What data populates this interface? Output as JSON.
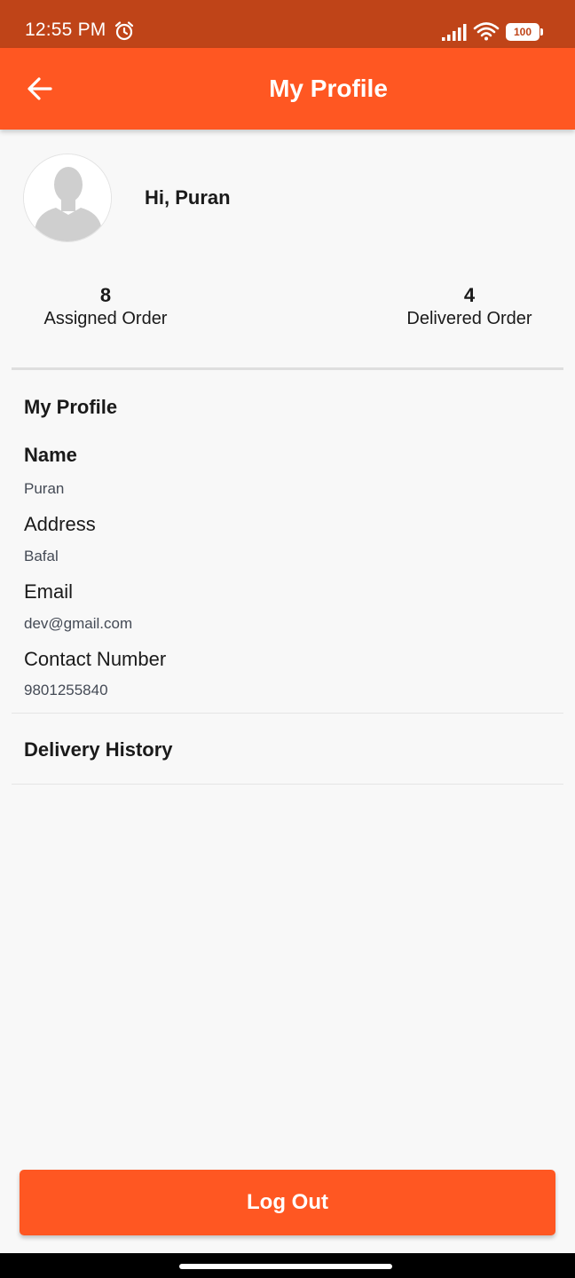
{
  "status_bar": {
    "time": "12:55 PM",
    "battery": "100",
    "icons": [
      "alarm-icon",
      "signal-icon",
      "wifi-icon",
      "battery-icon"
    ]
  },
  "app_bar": {
    "title": "My Profile",
    "back_icon": "arrow-left-icon",
    "color": "#ff5722"
  },
  "profile_header": {
    "greeting": "Hi, Puran",
    "avatar_icon": "person-silhouette-icon"
  },
  "stats": {
    "assigned": {
      "value": "8",
      "label": "Assigned Order"
    },
    "delivered": {
      "value": "4",
      "label": "Delivered Order"
    }
  },
  "details": {
    "section_title": "My Profile",
    "name_label": "Name",
    "name_value": "Puran",
    "address_label": "Address",
    "address_value": "Bafal",
    "email_label": "Email",
    "email_value": "dev@gmail.com",
    "contact_label": "Contact Number",
    "contact_value": "9801255840"
  },
  "delivery_history": {
    "label": "Delivery History"
  },
  "logout": {
    "label": "Log Out"
  },
  "colors": {
    "status_bar": "#bf4418",
    "accent": "#ff5722",
    "background": "#f8f8f8"
  }
}
